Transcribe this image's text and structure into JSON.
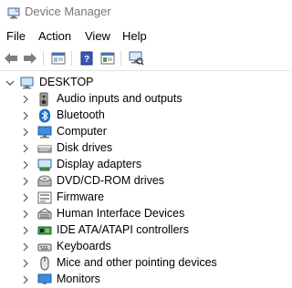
{
  "window": {
    "title": "Device Manager"
  },
  "menu": [
    "File",
    "Action",
    "View",
    "Help"
  ],
  "toolbar": {
    "buttons": [
      "back-icon",
      "forward-icon",
      "properties-icon",
      "help-icon",
      "update-driver-icon",
      "scan-hardware-icon"
    ]
  },
  "tree": {
    "root": "DESKTOP",
    "items": [
      {
        "label": "Audio inputs and outputs",
        "icon": "speaker-icon"
      },
      {
        "label": "Bluetooth",
        "icon": "bluetooth-icon"
      },
      {
        "label": "Computer",
        "icon": "computer-icon"
      },
      {
        "label": "Disk drives",
        "icon": "disk-drive-icon"
      },
      {
        "label": "Display adapters",
        "icon": "display-adapter-icon"
      },
      {
        "label": "DVD/CD-ROM drives",
        "icon": "dvd-drive-icon"
      },
      {
        "label": "Firmware",
        "icon": "firmware-icon"
      },
      {
        "label": "Human Interface Devices",
        "icon": "hid-icon"
      },
      {
        "label": "IDE ATA/ATAPI controllers",
        "icon": "ide-controller-icon"
      },
      {
        "label": "Keyboards",
        "icon": "keyboard-icon"
      },
      {
        "label": "Mice and other pointing devices",
        "icon": "mouse-icon"
      },
      {
        "label": "Monitors",
        "icon": "monitor-icon"
      }
    ]
  }
}
